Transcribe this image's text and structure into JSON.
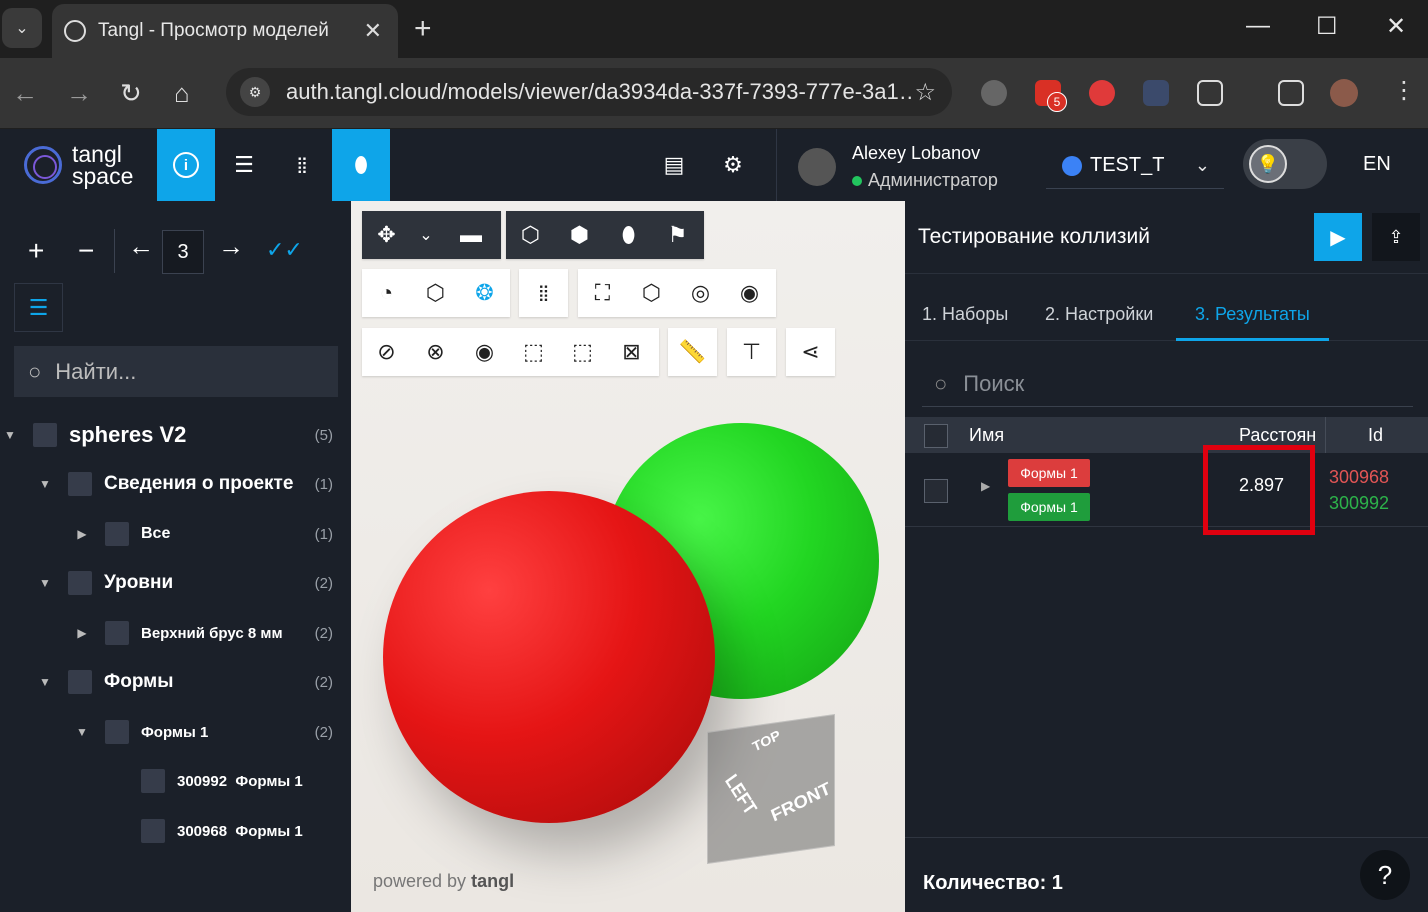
{
  "browser": {
    "tab_title": "Tangl - Просмотр моделей",
    "url": "auth.tangl.cloud/models/viewer/da3934da-337f-7393-777e-3a1…",
    "gmail_badge": "5"
  },
  "header": {
    "logo_line1": "tangl",
    "logo_line2": "space",
    "user_name": "Alexey Lobanov",
    "user_role": "Администратор",
    "project": "TEST_T",
    "lang": "EN"
  },
  "left": {
    "level_value": "3",
    "search_placeholder": "Найти...",
    "tree": [
      {
        "label": "spheres V2",
        "count": "(5)"
      },
      {
        "label": "Сведения о проекте",
        "count": "(1)"
      },
      {
        "label": "Все",
        "count": "(1)"
      },
      {
        "label": "Уровни",
        "count": "(2)"
      },
      {
        "label": "Верхний брус 8 мм",
        "count": "(2)"
      },
      {
        "label": "Формы",
        "count": "(2)"
      },
      {
        "label": "Формы 1",
        "count": "(2)"
      },
      {
        "label": "300992  Формы 1",
        "count": ""
      },
      {
        "label": "300968  Формы 1",
        "count": ""
      }
    ]
  },
  "viewer": {
    "cube_top": "TOP",
    "cube_left": "LEFT",
    "cube_front": "FRONT",
    "powered_by": "powered by",
    "powered_brand": "tangl"
  },
  "right": {
    "title": "Тестирование коллизий",
    "tabs": [
      "1. Наборы",
      "2. Настройки",
      "3. Результаты"
    ],
    "search_placeholder": "Поиск",
    "columns": [
      "Имя",
      "Расстоян",
      "Id"
    ],
    "row": {
      "tag_a": "Формы 1",
      "tag_b": "Формы 1",
      "distance": "2.897",
      "id_a": "300968",
      "id_b": "300992"
    },
    "count_label": "Количество: 1",
    "help": "?"
  },
  "colors": {
    "accent": "#0ea5e9",
    "tag_red": "#dc3d3d",
    "tag_green": "#1f9d3c",
    "highlight": "#e0000f"
  }
}
